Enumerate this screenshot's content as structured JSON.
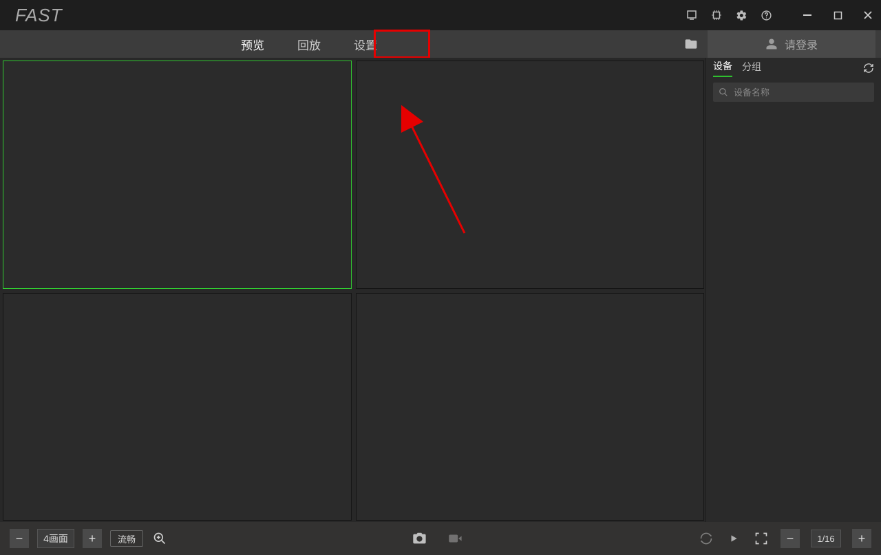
{
  "app": {
    "logo": "FAST"
  },
  "tabs": {
    "preview": "预览",
    "playback": "回放",
    "settings": "设置"
  },
  "login": {
    "label": "请登录"
  },
  "sidebar": {
    "tab_device": "设备",
    "tab_group": "分组",
    "search_placeholder": "设备名称"
  },
  "bottom": {
    "layout_label": "4画面",
    "stream_label": "流畅",
    "page_label": "1/16"
  }
}
